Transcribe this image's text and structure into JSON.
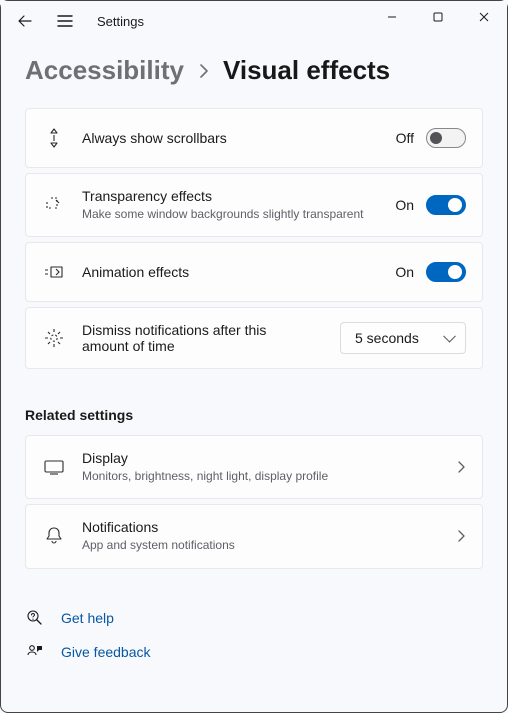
{
  "titlebar": {
    "title": "Settings"
  },
  "breadcrumb": {
    "parent": "Accessibility",
    "current": "Visual effects"
  },
  "settings": {
    "scrollbars": {
      "label": "Always show scrollbars",
      "state_label": "Off",
      "on": false
    },
    "transparency": {
      "label": "Transparency effects",
      "desc": "Make some window backgrounds slightly transparent",
      "state_label": "On",
      "on": true
    },
    "animation": {
      "label": "Animation effects",
      "state_label": "On",
      "on": true
    },
    "dismiss": {
      "label": "Dismiss notifications after this amount of time",
      "value": "5 seconds"
    }
  },
  "related": {
    "title": "Related settings",
    "display": {
      "label": "Display",
      "desc": "Monitors, brightness, night light, display profile"
    },
    "notifications": {
      "label": "Notifications",
      "desc": "App and system notifications"
    }
  },
  "help": {
    "get_help": "Get help",
    "feedback": "Give feedback"
  }
}
